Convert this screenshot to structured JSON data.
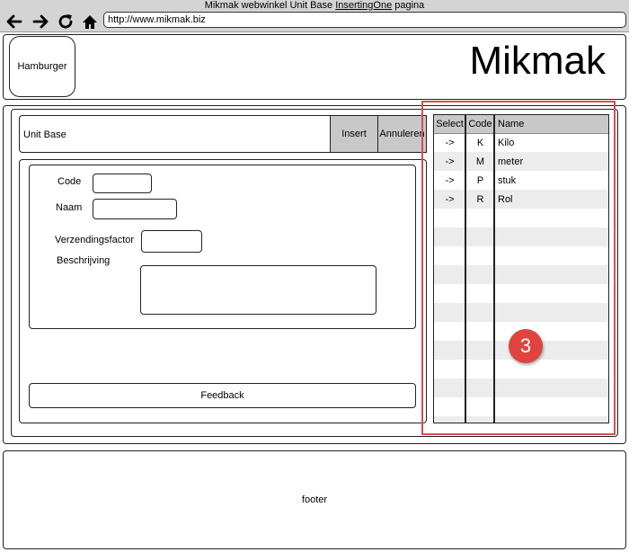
{
  "window": {
    "title_prefix": "Mikmak webwinkel Unit Base ",
    "title_underlined": "InsertingOne",
    "title_suffix": " pagina",
    "url": "http://www.mikmak.biz"
  },
  "header": {
    "hamburger_label": "Hamburger",
    "logo_text": "Mikmak"
  },
  "form": {
    "title": "Unit Base",
    "insert_label": "Insert",
    "cancel_label": "Annuleren",
    "code_label": "Code",
    "naam_label": "Naam",
    "verzendingsfactor_label": "Verzendingsfactor",
    "beschrijving_label": "Beschrijving",
    "feedback_label": "Feedback"
  },
  "grid": {
    "headers": [
      "Select",
      "Code",
      "Name"
    ],
    "rows": [
      {
        "select": "->",
        "code": "K",
        "name": "Kilo"
      },
      {
        "select": "->",
        "code": "M",
        "name": "meter"
      },
      {
        "select": "->",
        "code": "P",
        "name": "stuk"
      },
      {
        "select": "->",
        "code": "R",
        "name": "Rol"
      }
    ]
  },
  "annotation": {
    "badge_number": "3",
    "highlight_color": "#e04b4b"
  },
  "footer": {
    "label": "footer"
  }
}
